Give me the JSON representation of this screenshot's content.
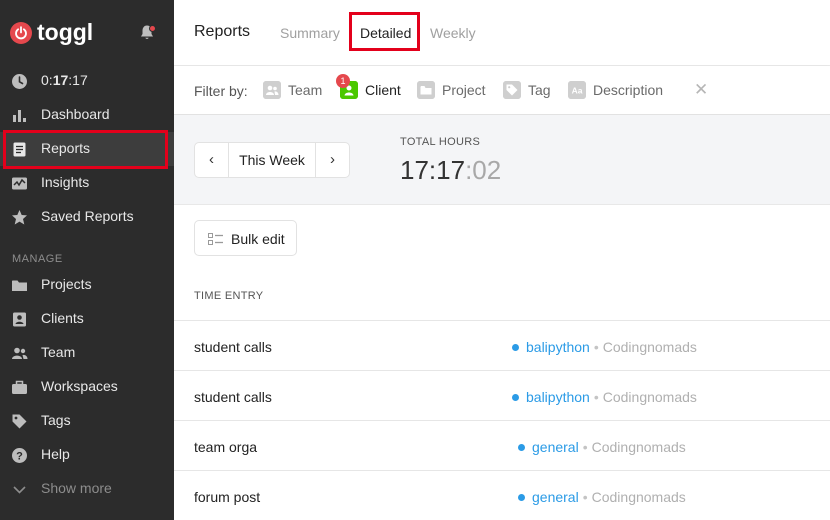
{
  "app": {
    "name": "toggl"
  },
  "sidebar": {
    "timer": {
      "prefix": "0:",
      "bold": "17",
      "suffix": ":17"
    },
    "items": [
      {
        "label": "Dashboard"
      },
      {
        "label": "Reports"
      },
      {
        "label": "Insights"
      },
      {
        "label": "Saved Reports"
      }
    ],
    "manage_label": "MANAGE",
    "manage_items": [
      {
        "label": "Projects"
      },
      {
        "label": "Clients"
      },
      {
        "label": "Team"
      },
      {
        "label": "Workspaces"
      },
      {
        "label": "Tags"
      },
      {
        "label": "Help"
      },
      {
        "label": "Show more"
      }
    ]
  },
  "header": {
    "title": "Reports",
    "tabs": [
      {
        "label": "Summary"
      },
      {
        "label": "Detailed"
      },
      {
        "label": "Weekly"
      }
    ]
  },
  "filters": {
    "label": "Filter by:",
    "items": [
      {
        "label": "Team"
      },
      {
        "label": "Client",
        "badge": "1"
      },
      {
        "label": "Project"
      },
      {
        "label": "Tag"
      },
      {
        "label": "Description"
      }
    ],
    "close": "✕"
  },
  "summary": {
    "period": "This Week",
    "total_label": "TOTAL HOURS",
    "total_main": "17:17",
    "total_seconds": ":02"
  },
  "toolbar": {
    "bulk_edit": "Bulk edit"
  },
  "table": {
    "column": "TIME ENTRY",
    "rows": [
      {
        "description": "student calls",
        "project": "balipython",
        "separator": "•",
        "client": "Codingnomads"
      },
      {
        "description": "student calls",
        "project": "balipython",
        "separator": "•",
        "client": "Codingnomads"
      },
      {
        "description": "team orga",
        "project": "general",
        "separator": "•",
        "client": "Codingnomads"
      },
      {
        "description": "forum post",
        "project": "general",
        "separator": "•",
        "client": "Codingnomads"
      }
    ]
  },
  "colors": {
    "sidebar_bg": "#2c2c2c",
    "brand": "#e5484d",
    "project_blue": "#2b9be6",
    "client_green": "#4bc800",
    "highlight": "#e3001b"
  }
}
